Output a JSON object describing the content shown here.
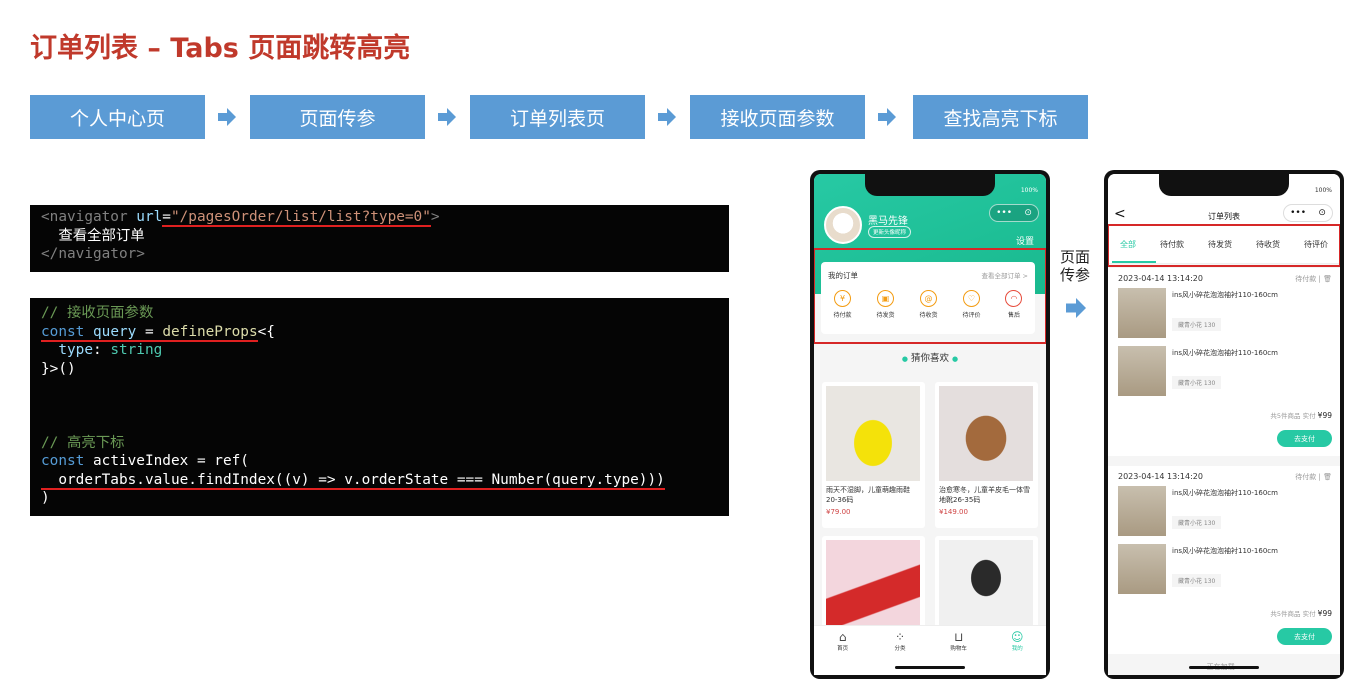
{
  "title": "订单列表 – Tabs 页面跳转高亮",
  "flow": {
    "steps": [
      "个人中心页",
      "页面传参",
      "订单列表页",
      "接收页面参数",
      "查找高亮下标"
    ],
    "arrow_color": "#5b9bd5"
  },
  "code1": {
    "open_tag_start": "<navigator",
    "attr": " url",
    "eq": "=",
    "value": "\"/pagesOrder/list/list?type=0\"",
    "open_tag_end": ">",
    "inner_text": "  查看全部订单",
    "close_tag": "</navigator>"
  },
  "code2": {
    "comment1": "// 接收页面参数",
    "l2_kw": "const",
    "l2_var": "query",
    "l2_eq": " = ",
    "l2_fn": "defineProps",
    "l2_rest": "<{",
    "l3_prop": "  type",
    "l3_colon": ": ",
    "l3_type": "string",
    "l4": "}>()",
    "comment2": "// 高亮下标",
    "l6_kw": "const",
    "l6_rest": " activeIndex = ref(",
    "l7": "  orderTabs.value.findIndex((v) => v.orderState === Number(query.type)))",
    "l8": ")"
  },
  "phone1": {
    "battery": "100%",
    "user_name": "黑马先锋",
    "edit_avatar": "更新头像昵称",
    "capsule_dots": "•••",
    "capsule_circle": "⊙",
    "settings": "设置",
    "my_orders": "我的订单",
    "view_all": "查看全部订单 >",
    "order_icons": [
      {
        "label": "待付款",
        "icon": "¥"
      },
      {
        "label": "待发货",
        "icon": "▣"
      },
      {
        "label": "待收货",
        "icon": "@"
      },
      {
        "label": "待评价",
        "icon": "♡"
      },
      {
        "label": "售后",
        "icon": "◠"
      }
    ],
    "guess": "猜你喜欢",
    "guess_dot": "●",
    "goods": [
      {
        "name": "雨天不湿脚，儿童萌趣雨鞋20-36码",
        "price": "¥79.00"
      },
      {
        "name": "治愈寒冬，儿童羊皮毛一体雪地靴26-35码",
        "price": "¥149.00"
      }
    ],
    "tabbar": [
      {
        "label": "首页",
        "icon": "⌂"
      },
      {
        "label": "分类",
        "icon": "⁘"
      },
      {
        "label": "购物车",
        "icon": "⊔"
      },
      {
        "label": "我的",
        "icon": "☺"
      }
    ],
    "accent": "#27c9a4"
  },
  "side_label": {
    "line1": "页面",
    "line2": "传参"
  },
  "phone2": {
    "battery": "100%",
    "back": "<",
    "nav_title": "订单列表",
    "capsule_dots": "•••",
    "capsule_circle": "⊙",
    "tabs": [
      "全部",
      "待付款",
      "待发货",
      "待收货",
      "待评价"
    ],
    "orders": [
      {
        "time": "2023-04-14 13:14:20",
        "state": "待付款 | 🗑",
        "items": [
          {
            "name": "ins风小碎花泡泡袖衬110-160cm",
            "attr": "藏青小花 130"
          },
          {
            "name": "ins风小碎花泡泡袖衬110-160cm",
            "attr": "藏青小花 130"
          }
        ],
        "summary_prefix": "共5件商品  实付 ",
        "summary_amount": "¥99",
        "pay": "去支付"
      },
      {
        "time": "2023-04-14 13:14:20",
        "state": "待付款 | 🗑",
        "items": [
          {
            "name": "ins风小碎花泡泡袖衬110-160cm",
            "attr": "藏青小花 130"
          },
          {
            "name": "ins风小碎花泡泡袖衬110-160cm",
            "attr": "藏青小花 130"
          }
        ],
        "summary_prefix": "共5件商品  实付 ",
        "summary_amount": "¥99",
        "pay": "去支付"
      }
    ],
    "loading": "正在加载..."
  },
  "colors": {
    "title": "#c0392b",
    "flow": "#5b9bd5",
    "highlight": "#d62828",
    "accent": "#27c9a4"
  }
}
